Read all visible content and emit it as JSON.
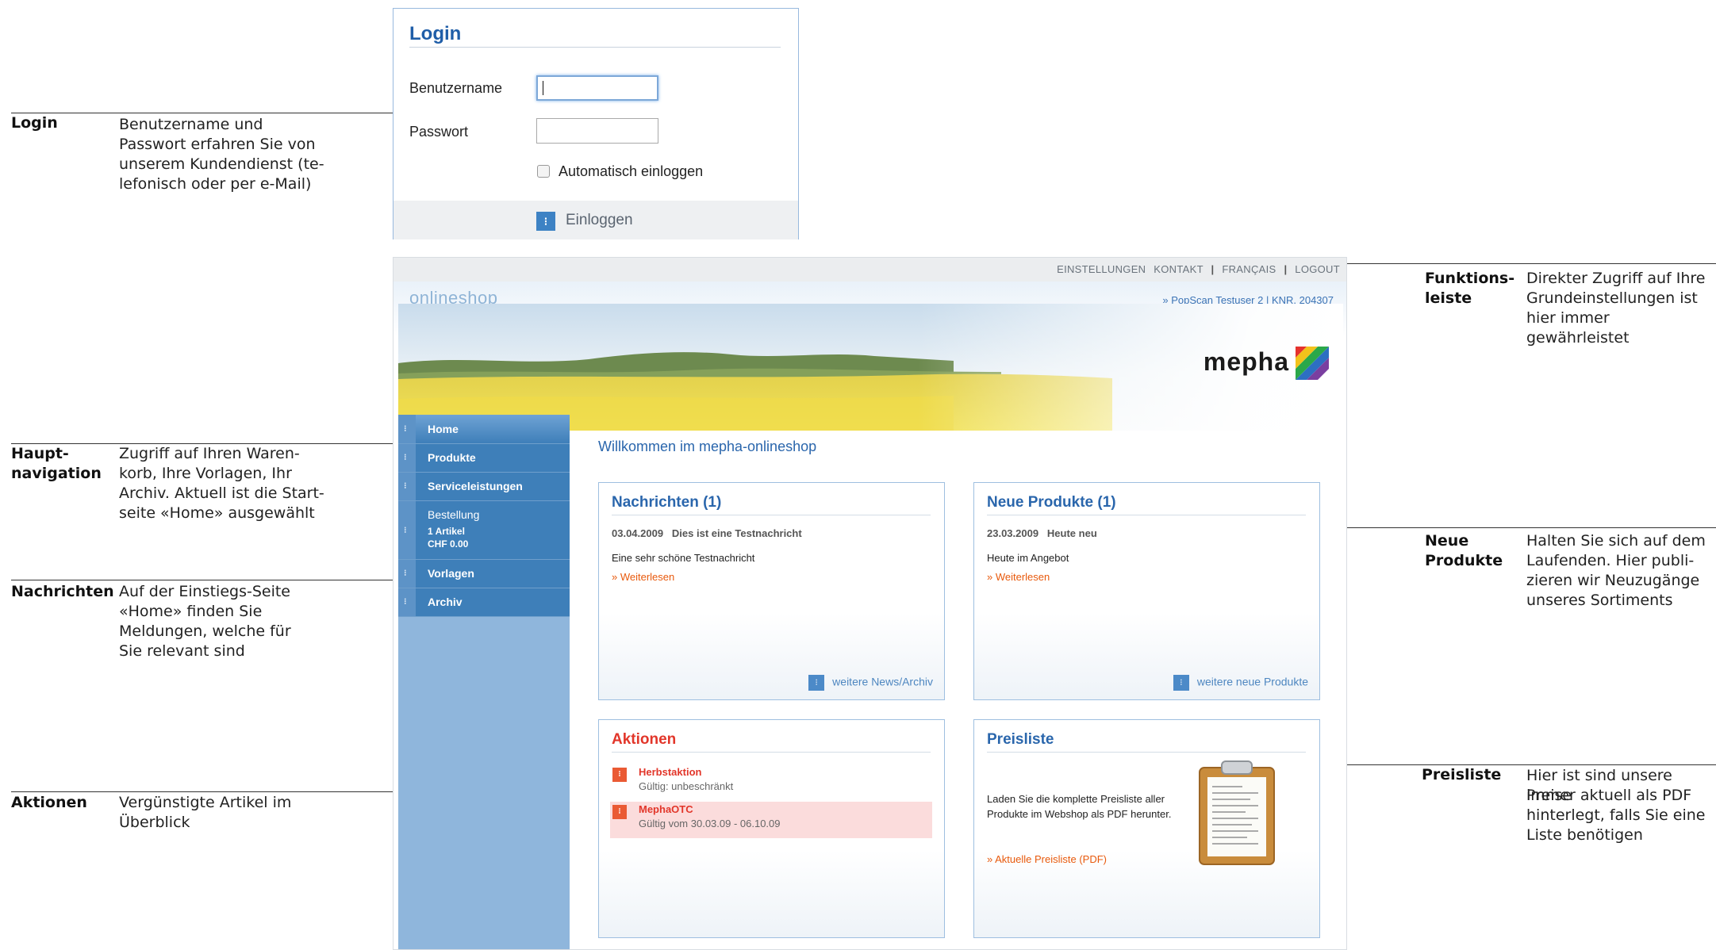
{
  "annotations": [
    {
      "id": "login",
      "title": "Login",
      "text": [
        "Benutzername und",
        "Passwort erfahren Sie von",
        "unserem Kundendienst (te-",
        "lefonisch oder per e-Mail)"
      ]
    },
    {
      "id": "navigation",
      "title": "Haupt-\nnavigation",
      "text": [
        "Zugriff auf Ihren Waren-",
        "korb, Ihre Vorlagen, Ihr",
        "Archiv. Aktuell ist die Start-",
        "seite «Home» ausgewählt"
      ]
    },
    {
      "id": "news",
      "title": "Nachrichten",
      "text": [
        "Auf der Einstiegs-Seite",
        "«Home» finden Sie",
        "Meldungen, welche für",
        "Sie relevant sind"
      ]
    },
    {
      "id": "actions",
      "title": "Aktionen",
      "text": [
        "Vergünstigte Artikel im",
        "Überblick"
      ]
    },
    {
      "id": "functions",
      "title": "Funktions-\nleiste",
      "text": [
        "Direkter Zugriff auf Ihre",
        "Grundeinstellungen ist",
        "hier immer gewährleistet"
      ]
    },
    {
      "id": "newproducts",
      "title": "Neue\nProdukte",
      "text": [
        "Halten Sie sich auf dem",
        "Laufenden. Hier publi-",
        "zieren wir Neuzugänge",
        "unseres Sortiments"
      ]
    },
    {
      "id": "pricelist",
      "title": "Preisliste",
      "text": [
        "Hier ist sind unsere Preise",
        "immer aktuell als PDF",
        "hinterlegt, falls Sie eine",
        "Liste benötigen"
      ]
    }
  ],
  "login": {
    "title": "Login",
    "username_label": "Benutzername",
    "password_label": "Passwort",
    "username_value": "",
    "password_value": "",
    "auto_login_label": "Automatisch einloggen",
    "auto_login_checked": false,
    "submit_label": "Einloggen"
  },
  "shop": {
    "topbar": {
      "settings": "EINSTELLUNGEN",
      "contact": "KONTAKT",
      "language": "FRANÇAIS",
      "logout": "LOGOUT"
    },
    "name": "onlineshop",
    "user_info": "» PopScan Testuser 2 | KNR. 204307",
    "brand": "mepha",
    "nav": [
      {
        "label": "Home",
        "active": true
      },
      {
        "label": "Produkte"
      },
      {
        "label": "Serviceleistungen"
      },
      {
        "label": "Bestellung",
        "sub1": "1 Artikel",
        "sub2": "CHF 0.00"
      },
      {
        "label": "Vorlagen"
      },
      {
        "label": "Archiv"
      }
    ],
    "welcome": "Willkommen im mepha-onlineshop",
    "news": {
      "title": "Nachrichten (1)",
      "date": "03.04.2009",
      "headline": "Dies ist eine Testnachricht",
      "body": "Eine sehr schöne Testnachricht",
      "more": "» Weiterlesen",
      "footer": "weitere News/Archiv"
    },
    "new_products": {
      "title": "Neue Produkte (1)",
      "date": "23.03.2009",
      "headline": "Heute neu",
      "body": "Heute im Angebot",
      "more": "» Weiterlesen",
      "footer": "weitere neue Produkte"
    },
    "actions": {
      "title": "Aktionen",
      "items": [
        {
          "name": "Herbstaktion",
          "validity": "Gültig: unbeschränkt"
        },
        {
          "name": "MephaOTC",
          "validity": "Gültig vom 30.03.09 - 06.10.09"
        }
      ]
    },
    "pricelist": {
      "title": "Preisliste",
      "text": "Laden Sie die komplette Preisliste aller Produkte im Webshop als PDF herunter.",
      "link": "» Aktuelle Preisliste (PDF)"
    }
  },
  "colors": {
    "accent_blue": "#2a66ac",
    "nav_blue": "#3e7fb9",
    "orange_link": "#e8590c",
    "action_red": "#e2362a"
  }
}
